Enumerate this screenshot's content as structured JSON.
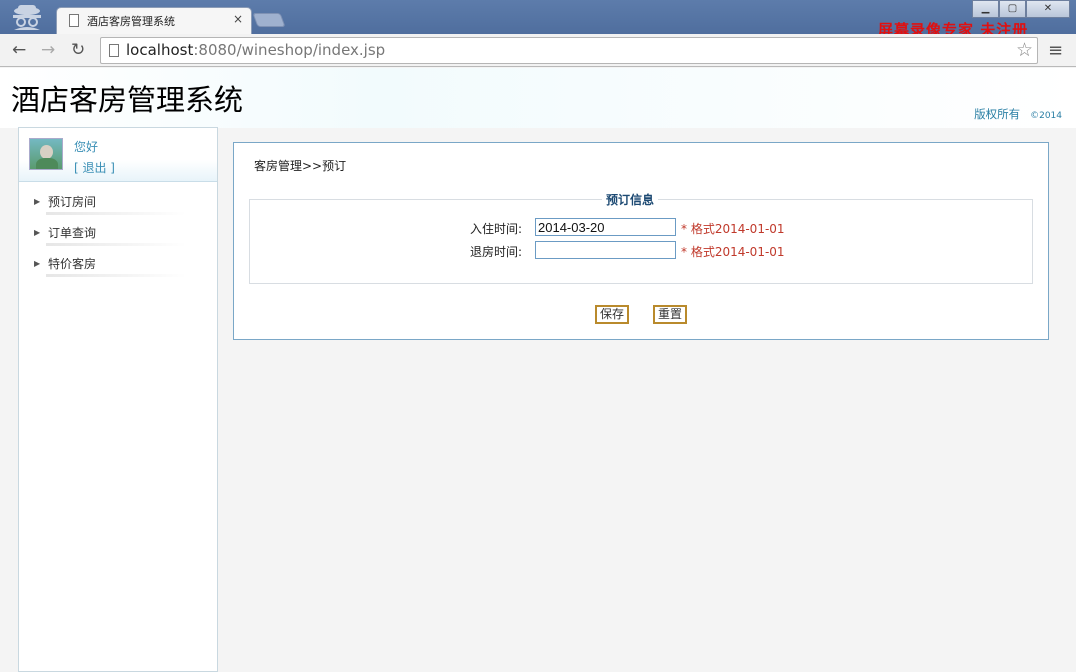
{
  "browser": {
    "tab_title": "酒店客房管理系统",
    "tab_close": "×",
    "url_host": "localhost",
    "url_rest": ":8080/wineshop/index.jsp",
    "back_icon": "←",
    "forward_icon": "→",
    "reload_icon": "↻",
    "star_icon": "☆",
    "menu_icon": "≡",
    "win_min": "▁",
    "win_max": "▢",
    "win_close": "✕"
  },
  "watermark": "屏幕录像专家 未注册",
  "header": {
    "title": "酒店客房管理系统",
    "copyright": "版权所有",
    "year": "©2014"
  },
  "sidebar": {
    "greeting": "您好",
    "logout": "[ 退出 ]",
    "items": [
      {
        "label": "预订房间"
      },
      {
        "label": "订单查询"
      },
      {
        "label": "特价客房"
      }
    ]
  },
  "main": {
    "breadcrumb": "客房管理>>预订",
    "legend": "预订信息",
    "checkin_label": "入住时间:",
    "checkin_value": "2014-03-20",
    "checkin_hint": "* 格式2014-01-01",
    "checkout_label": "退房时间:",
    "checkout_value": "",
    "checkout_hint": "* 格式2014-01-01",
    "save_label": "保存",
    "reset_label": "重置"
  },
  "colors": {
    "accent": "#3a8fb5",
    "hint_red": "#c0392b",
    "button_border": "#b98a2c"
  }
}
